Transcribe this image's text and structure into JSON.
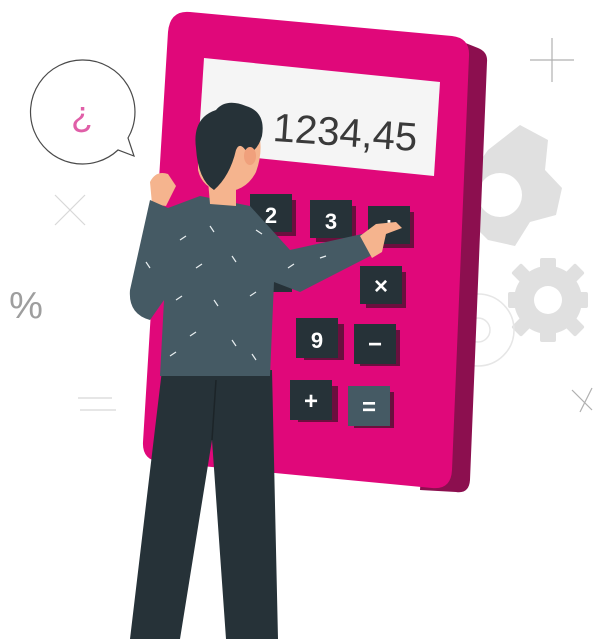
{
  "calculator": {
    "display_value": "1234,45",
    "visible_keys": {
      "k2": "2",
      "k3": "3",
      "divide": "÷",
      "k9_partial": "9",
      "multiply": "×",
      "k9": "9",
      "minus": "−",
      "plus": "+",
      "equals": "="
    }
  },
  "decor": {
    "speech_bubble_symbol": "¿",
    "percent_symbol": "%"
  },
  "colors": {
    "calculator_body": "#e0087a",
    "calculator_side": "#8c0f4f",
    "display_bg": "#f5f5f5",
    "key_dark": "#263238",
    "key_equals": "#455a64",
    "key_shadow": "#6b0f3e",
    "shirt": "#455a64",
    "pants": "#263238",
    "hair": "#263238",
    "skin": "#f5b48e",
    "gear": "#e0e0e0",
    "accent_pink": "#e05fa8"
  }
}
